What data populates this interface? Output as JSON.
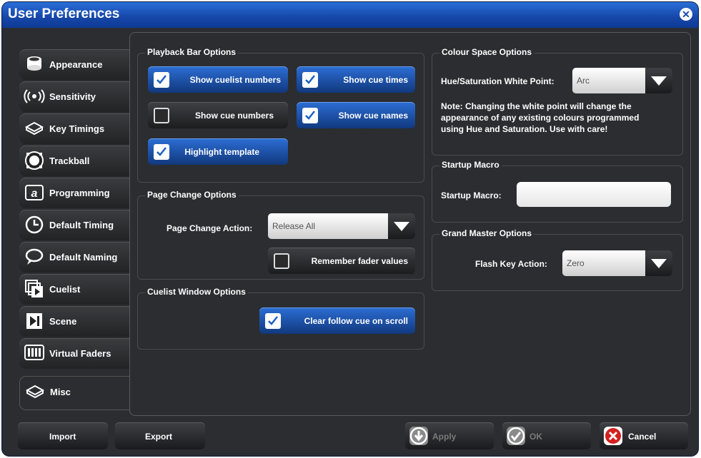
{
  "window": {
    "title": "User Preferences"
  },
  "tabs": [
    {
      "label": "Appearance",
      "icon": "appearance-icon"
    },
    {
      "label": "Sensitivity",
      "icon": "sensitivity-icon"
    },
    {
      "label": "Key Timings",
      "icon": "key-timings-icon"
    },
    {
      "label": "Trackball",
      "icon": "trackball-icon"
    },
    {
      "label": "Programming",
      "icon": "programming-icon"
    },
    {
      "label": "Default Timing",
      "icon": "clock-icon"
    },
    {
      "label": "Default Naming",
      "icon": "speech-bubble-icon"
    },
    {
      "label": "Cuelist",
      "icon": "cuelist-icon"
    },
    {
      "label": "Scene",
      "icon": "scene-icon"
    },
    {
      "label": "Virtual Faders",
      "icon": "virtual-faders-icon"
    },
    {
      "label": "Misc",
      "icon": "misc-icon",
      "active": true
    }
  ],
  "playback": {
    "title": "Playback Bar Options",
    "show_cuelist_numbers": {
      "label": "Show cuelist numbers",
      "checked": true
    },
    "show_cue_times": {
      "label": "Show cue times",
      "checked": true
    },
    "show_cue_numbers": {
      "label": "Show cue numbers",
      "checked": false
    },
    "show_cue_names": {
      "label": "Show cue names",
      "checked": true
    },
    "highlight_template": {
      "label": "Highlight template",
      "checked": true
    }
  },
  "page_change": {
    "title": "Page Change Options",
    "action_label": "Page Change Action:",
    "action_value": "Release All",
    "remember_fader": {
      "label": "Remember fader values",
      "checked": false
    }
  },
  "cuelist_window": {
    "title": "Cuelist Window Options",
    "clear_follow": {
      "label": "Clear follow cue on scroll",
      "checked": true
    }
  },
  "colour_space": {
    "title": "Colour Space Options",
    "white_point_label": "Hue/Saturation White Point:",
    "white_point_value": "Arc",
    "note_bold": "Note:",
    "note_line1": " Changing the white point will change the",
    "note_line2": "appearance of any existing colours programmed",
    "note_line3": "using Hue and Saturation. Use with care!"
  },
  "startup_macro": {
    "title": "Startup Macro",
    "label": "Startup Macro:",
    "value": ""
  },
  "grand_master": {
    "title": "Grand Master Options",
    "flash_label": "Flash Key Action:",
    "flash_value": "Zero"
  },
  "buttons": {
    "import": "Import",
    "export": "Export",
    "apply": "Apply",
    "ok": "OK",
    "cancel": "Cancel"
  },
  "colors": {
    "title_blue": "#1a4fb5",
    "checked_blue": "#2a6bd0",
    "cancel_red": "#d32020"
  }
}
